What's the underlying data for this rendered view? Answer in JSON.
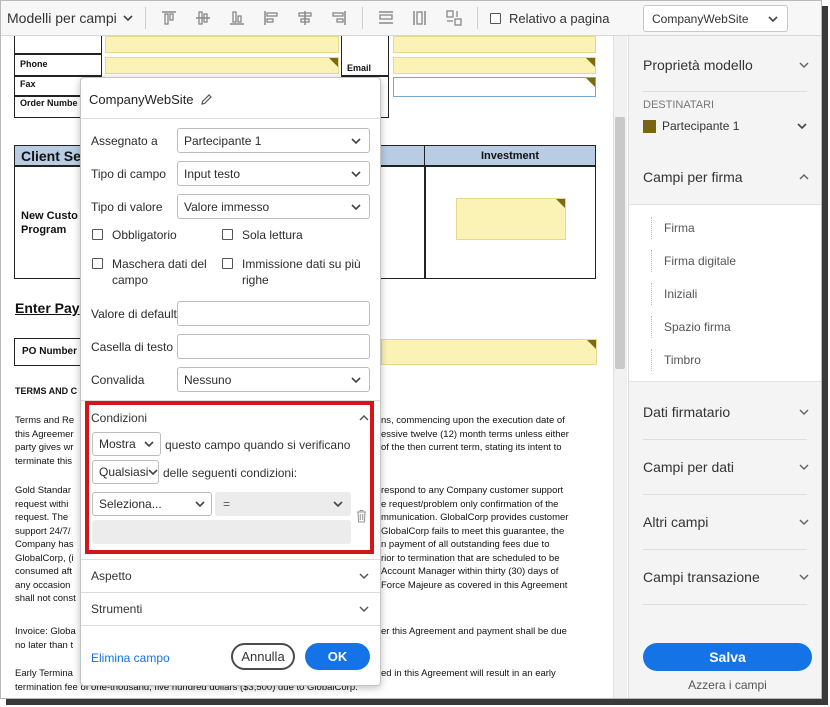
{
  "toolbar": {
    "templates_menu": "Modelli per campi",
    "relative_to_page": "Relativo a pagina",
    "template_select": "CompanyWebSite"
  },
  "document": {
    "labels": {
      "phone": "Phone",
      "fax": "Fax",
      "order_number": "Order Numbe",
      "email": "Email",
      "client_services": "Client Se",
      "investment": "Investment",
      "new_customer": "New Custo",
      "program": "Program",
      "enter_payment": "Enter Pay",
      "po_number": "PO Number",
      "terms": "TERMS AND C"
    },
    "paragraphs": {
      "terms_left": "Terms and Re\nthis Agreemer\nparty gives wr\nterminate this",
      "terms_right": "ns, commencing upon the execution date of\nessive twelve (12) month terms unless either\nof the then current term, stating its intent to",
      "gold_left": "Gold Standar\nrequest withi\nrequest. The\nsupport 24/7/\nCompany has\nGlobalCorp, (i\nconsumed aft\nany occasion\nshall not const",
      "gold_right": "respond to any Company customer support\ne request/problem only confirmation of the\nmmunication. GlobalCorp provides customer\nGlobalCorp fails to meet this guarantee, the\nn payment of all outstanding fees due to\nrior to termination that are scheduled to be\nAccount Manager within thirty (30) days of\nForce Majeure as covered in this Agreement",
      "invoice_left": "Invoice: Globa\nno later than t",
      "invoice_right": "er this Agreement and payment shall be due",
      "early_left": "Early Termina",
      "early_right": "ed in this Agreement will result in an early",
      "early_bottom": "termination fee of one-thousand, five hundred dollars ($3,500) due to GlobalCorp."
    }
  },
  "dialog": {
    "title": "CompanyWebSite",
    "assigned_to_label": "Assegnato a",
    "assigned_to_value": "Partecipante 1",
    "field_type_label": "Tipo di campo",
    "field_type_value": "Input testo",
    "value_type_label": "Tipo di valore",
    "value_type_value": "Valore immesso",
    "required": "Obbligatorio",
    "read_only": "Sola lettura",
    "field_mask": "Maschera dati del campo",
    "multiline": "Immissione dati su più righe",
    "default_value_label": "Valore di default",
    "default_value": "",
    "tooltip_label": "Casella di testo",
    "tooltip_value": "",
    "validation_label": "Convalida",
    "validation_value": "Nessuno",
    "conditions": {
      "title": "Condizioni",
      "action": "Mostra",
      "action_text": "questo campo quando si verificano",
      "match": "Qualsiasi",
      "match_text": "delle seguenti condizioni:",
      "field_select": "Seleziona...",
      "operator": "="
    },
    "appearance": "Aspetto",
    "tools": "Strumenti",
    "delete_field": "Elimina campo",
    "cancel": "Annulla",
    "ok": "OK"
  },
  "right_panel": {
    "template_properties": "Proprietà modello",
    "recipients_title": "DESTINATARI",
    "recipient": "Partecipante 1",
    "recipient_color": "#7a6516",
    "signature_fields_title": "Campi per firma",
    "signature_fields": [
      "Firma",
      "Firma digitale",
      "Iniziali",
      "Spazio firma",
      "Timbro"
    ],
    "signer_data": "Dati firmatario",
    "data_fields": "Campi per dati",
    "other_fields": "Altri campi",
    "transaction_fields": "Campi transazione",
    "save": "Salva",
    "reset_fields": "Azzera i campi"
  },
  "colors": {
    "accent": "#1473e6",
    "highlight_box": "#d4161a",
    "field_yellow": "#fbf2b6",
    "table_header": "#b8cde3"
  }
}
